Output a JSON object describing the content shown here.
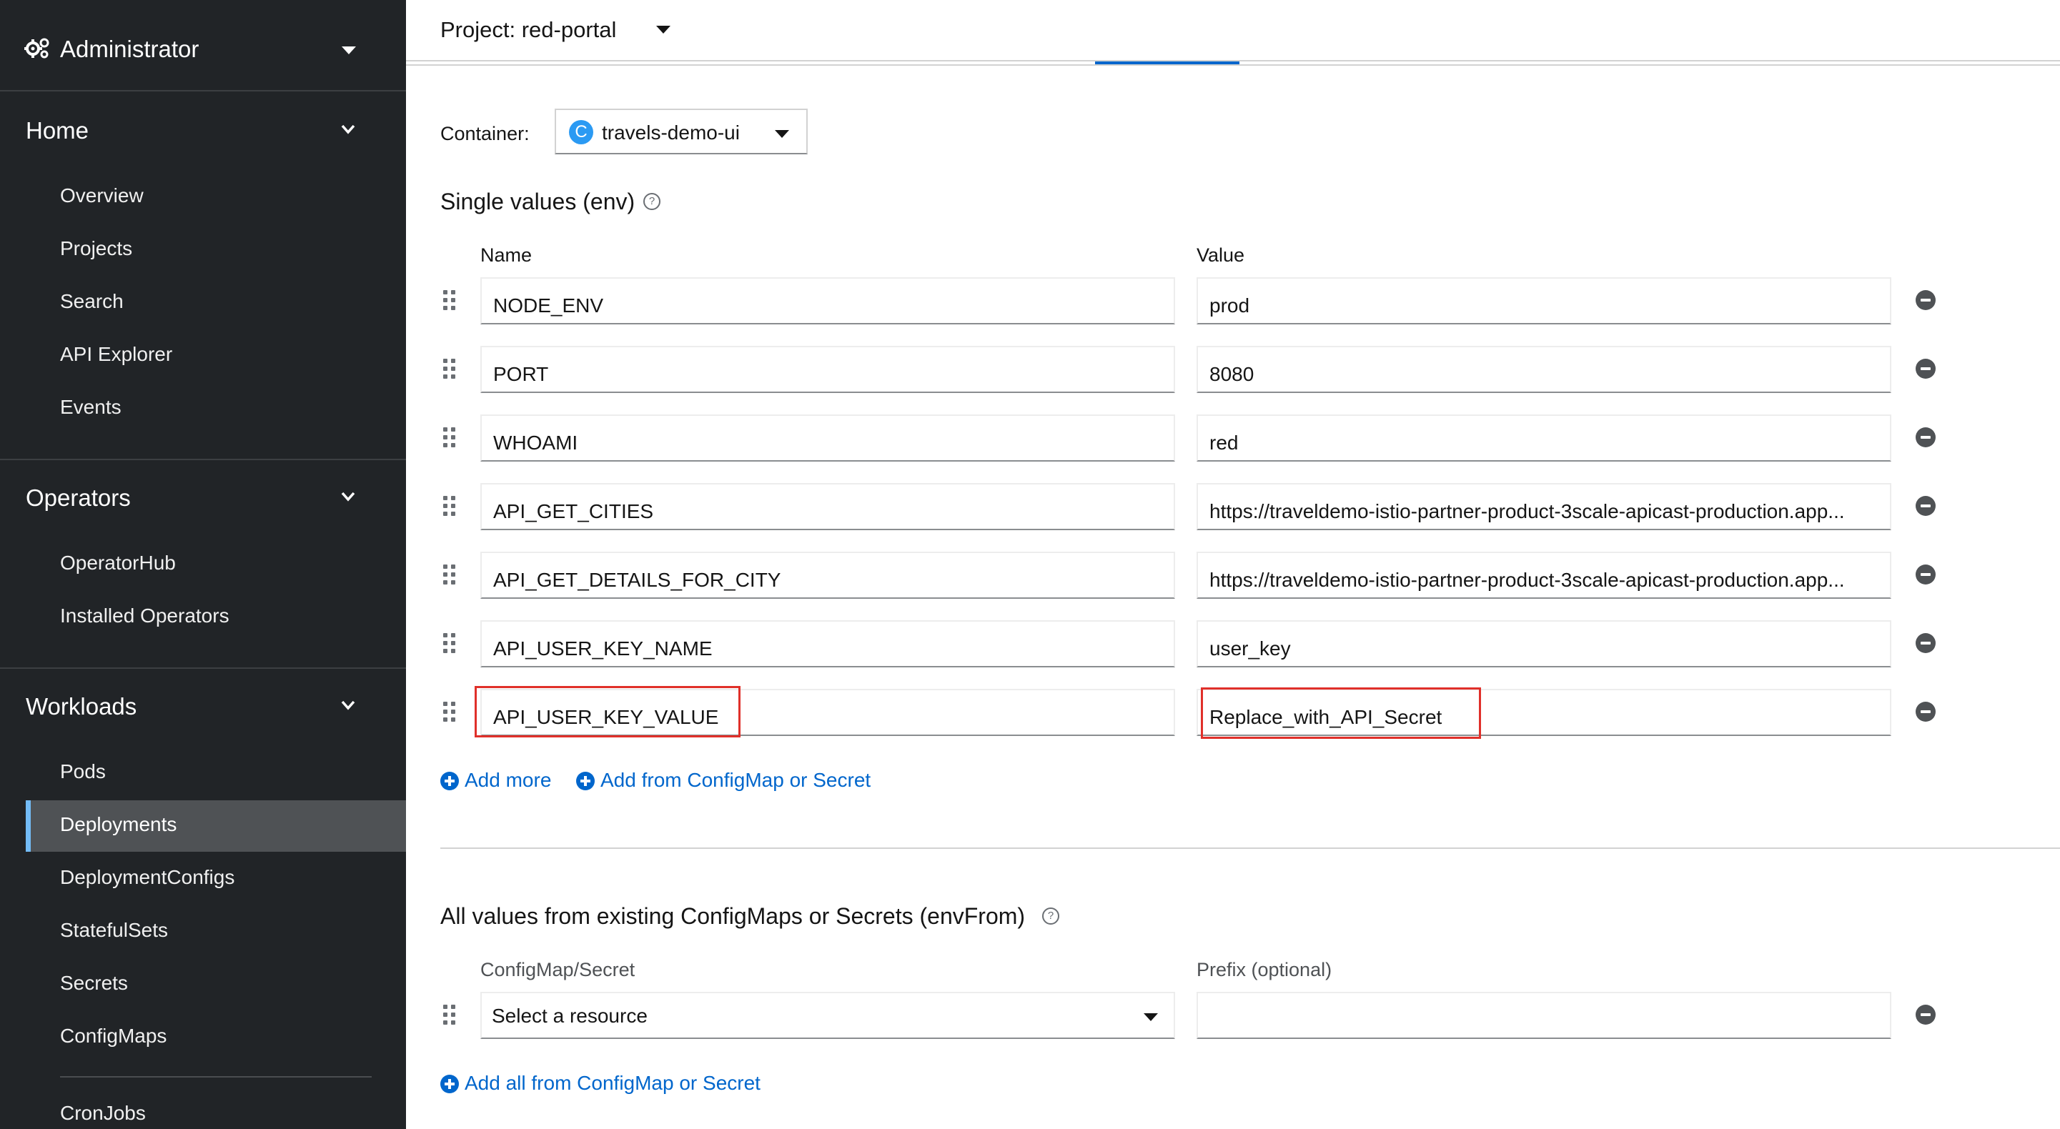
{
  "sidebar": {
    "perspective": {
      "label": "Administrator",
      "icon": "gears-icon"
    },
    "sections": [
      {
        "label": "Home",
        "items": [
          "Overview",
          "Projects",
          "Search",
          "API Explorer",
          "Events"
        ]
      },
      {
        "label": "Operators",
        "items": [
          "OperatorHub",
          "Installed Operators"
        ]
      },
      {
        "label": "Workloads",
        "items": [
          "Pods",
          "Deployments",
          "DeploymentConfigs",
          "StatefulSets",
          "Secrets",
          "ConfigMaps",
          "CronJobs"
        ]
      }
    ],
    "active_item": "Deployments",
    "active_color": "#73bcf7"
  },
  "project": {
    "label": "Project: red-portal"
  },
  "container": {
    "label": "Container:",
    "badge": "C",
    "value": "travels-demo-ui"
  },
  "single_values": {
    "title": "Single values (env)",
    "name_header": "Name",
    "value_header": "Value",
    "rows": [
      {
        "name": "NODE_ENV",
        "value": "prod"
      },
      {
        "name": "PORT",
        "value": "8080"
      },
      {
        "name": "WHOAMI",
        "value": "red"
      },
      {
        "name": "API_GET_CITIES",
        "value": "https://traveldemo-istio-partner-product-3scale-apicast-production.app..."
      },
      {
        "name": "API_GET_DETAILS_FOR_CITY",
        "value": "https://traveldemo-istio-partner-product-3scale-apicast-production.app..."
      },
      {
        "name": "API_USER_KEY_NAME",
        "value": "user_key"
      },
      {
        "name": "API_USER_KEY_VALUE",
        "value": "Replace_with_API_Secret"
      }
    ],
    "add_more": "Add more",
    "add_from": "Add from ConfigMap or Secret"
  },
  "env_from": {
    "title": "All values from existing ConfigMaps or Secrets (envFrom)",
    "resource_header": "ConfigMap/Secret",
    "prefix_header": "Prefix (optional)",
    "resource_placeholder": "Select a resource",
    "prefix_value": "",
    "add_all": "Add all from ConfigMap or Secret"
  },
  "colors": {
    "sidebar_bg": "#212427",
    "link": "#0066cc",
    "highlight": "#e0302a"
  }
}
